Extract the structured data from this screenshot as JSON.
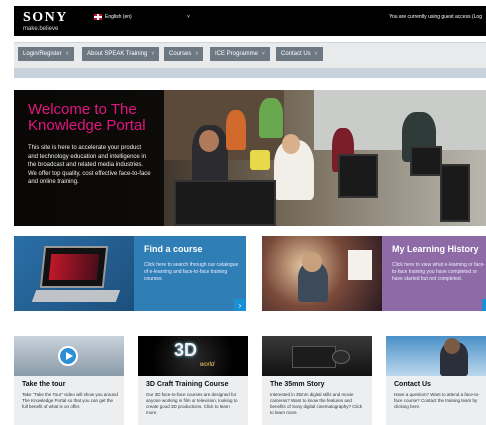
{
  "header": {
    "logo": "SONY",
    "tagline": "make.believe",
    "language": "English (en)",
    "caret": "˅",
    "user_status": "You are currently using guest access (Log"
  },
  "nav": {
    "items": [
      {
        "label": "Login/Register"
      },
      {
        "label": "About SPEAK Training"
      },
      {
        "label": "Courses"
      },
      {
        "label": "ICE Programme"
      },
      {
        "label": "Contact Us"
      }
    ],
    "chevron": "˅"
  },
  "hero": {
    "title": "Welcome to The Knowledge Portal",
    "body": "This site is here to accelerate your product and technology education and intelligence in the broadcast and related media industries. We offer top quality, cost effective face-to-face and online training."
  },
  "cards": [
    {
      "title": "Find a course",
      "desc": "Click here to search through our catalogue of e-learning and face-to-face training courses.",
      "arrow": "›",
      "color": "#2f7fb6"
    },
    {
      "title": "My Learning History",
      "desc": "Click here to view what e-learning or face-to-face training you have completed or have started but not completed.",
      "arrow": "›",
      "color": "#8e6aa6"
    }
  ],
  "tiles": [
    {
      "title": "Take the tour",
      "desc": "Take \"Take the Tour\" video will show you around The Knowledge Portal so that you can get the full benefit of what is on offer."
    },
    {
      "title": "3D Craft Training Course",
      "desc": "Our 3D face-to-face courses are designed for anyone working in film or television, looking to create good 3D productions. Click to learn more.",
      "badge": "3D",
      "badge_sub": "world"
    },
    {
      "title": "The 35mm Story",
      "desc": "Interested in 35mm digital stills and movie cameras? Want to know the features and benefits of Sony digital cinematography? Click to learn more."
    },
    {
      "title": "Contact Us",
      "desc": "Have a question? Want to attend a face-to-face course? Contact the training team by clicking here."
    }
  ]
}
